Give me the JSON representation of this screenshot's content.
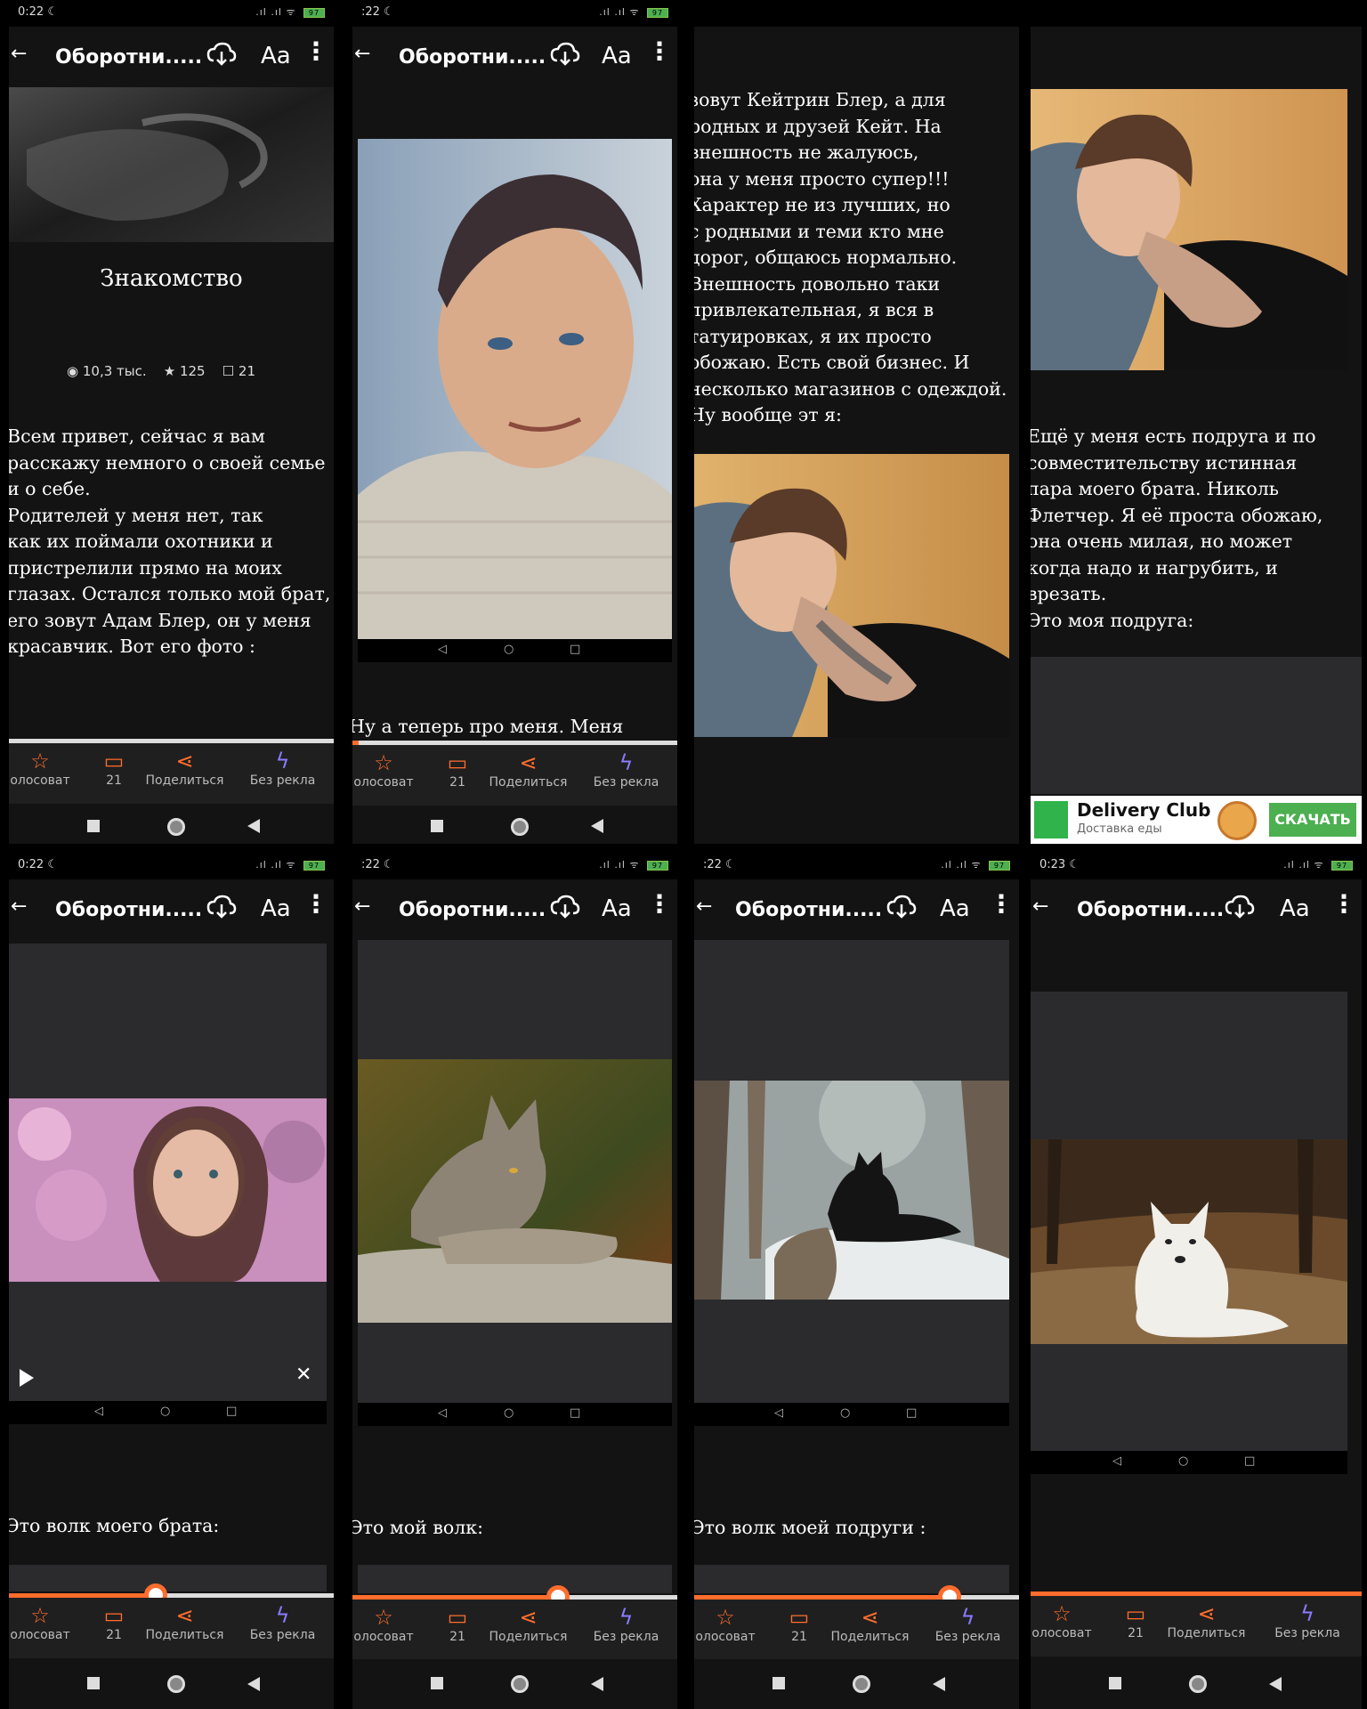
{
  "status": {
    "times": [
      "0:22",
      ":22",
      ":22",
      ":22",
      "0:22",
      ":22",
      ":22",
      "0:23"
    ],
    "battery": "97"
  },
  "header": {
    "title": "Оборотни.....",
    "font_label": "Aa"
  },
  "bottom_bar": {
    "vote": "олосоват",
    "comments": "21",
    "share": "Поделиться",
    "noads": "Без рекла"
  },
  "chapter": {
    "title": "Знакомство",
    "views": "10,3 тыс.",
    "stars": "125",
    "comments": "21"
  },
  "texts": {
    "p1": "Всем привет, сейчас я вам\nрасскажу немного о своей семье\nи о себе.\nРодителей у меня нет, так\nкак их поймали охотники и\nпристрелили прямо на моих\nглазах. Остался только мой брат,\nего зовут Адам Блер, он у меня\nкрасавчик. Вот его фото :",
    "p2": "Ну а теперь про меня. Меня",
    "p3": "зовут Кейтрин Блер, а для\nродных и друзей Кейт. На\nвнешность не жалуюсь,\nона у меня просто супер!!!\nХарактер не из лучших, но\nс родными и теми кто мне\nдорог, общаюсь нормально.\nВнешность довольно таки\nпривлекательная, я вся в\nтатуировках, я их просто\nобожаю. Есть свой бизнес. И\nнесколько магазинов с одеждой.\nНу вообще эт я:",
    "p4": "Ещё у меня есть подруга и по\nсовместительству истинная\nпара моего брата. Николь\nФлетчер. Я её проста обожаю,\nона очень милая, но может\nкогда надо и нагрубить, и\nврезать.\nЭто моя подруга:",
    "p5": "Это волк моего брата:",
    "p6": "Это мой волк:",
    "p7": "Это волк моей подруги :"
  },
  "ad": {
    "brand": "Delivery Club",
    "tagline": "Доставка еды",
    "cta": "СКАЧАТЬ"
  },
  "progress": {
    "panel1": 1.0,
    "panel2": 0.02,
    "panel5": 0.46,
    "panel6": 0.63,
    "panel7": 0.78,
    "panel8": 1.0
  }
}
